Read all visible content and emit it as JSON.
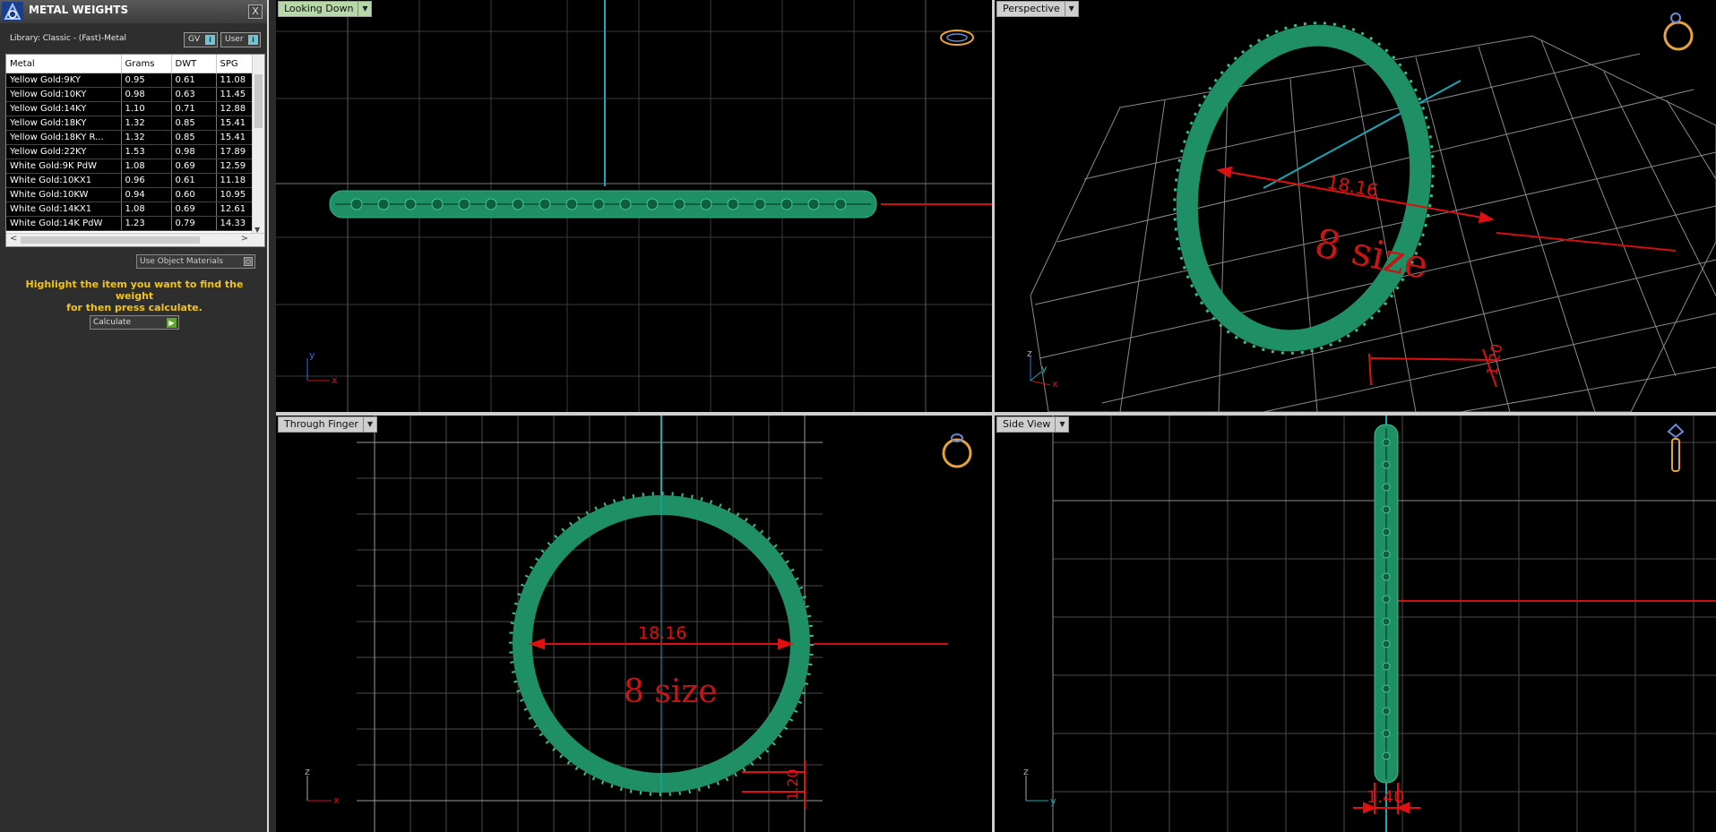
{
  "panel": {
    "title": "METAL WEIGHTS",
    "close_label": "X",
    "library_label": "Library: Classic - (Fast)-Metal",
    "gv_label": "GV",
    "user_label": "User",
    "toggle_mark": "i",
    "columns": [
      "Metal",
      "Grams",
      "DWT",
      "SPG"
    ],
    "rows": [
      [
        "Yellow Gold:9KY",
        "0.95",
        "0.61",
        "11.08"
      ],
      [
        "Yellow Gold:10KY",
        "0.98",
        "0.63",
        "11.45"
      ],
      [
        "Yellow Gold:14KY",
        "1.10",
        "0.71",
        "12.88"
      ],
      [
        "Yellow Gold:18KY",
        "1.32",
        "0.85",
        "15.41"
      ],
      [
        "Yellow Gold:18KY R...",
        "1.32",
        "0.85",
        "15.41"
      ],
      [
        "Yellow Gold:22KY",
        "1.53",
        "0.98",
        "17.89"
      ],
      [
        "White Gold:9K PdW",
        "1.08",
        "0.69",
        "12.59"
      ],
      [
        "White Gold:10KX1",
        "0.96",
        "0.61",
        "11.18"
      ],
      [
        "White Gold:10KW",
        "0.94",
        "0.60",
        "10.95"
      ],
      [
        "White Gold:14KX1",
        "1.08",
        "0.69",
        "12.61"
      ],
      [
        "White Gold:14K PdW",
        "1.23",
        "0.79",
        "14.33"
      ]
    ],
    "use_materials_label": "Use Object Materials",
    "instructions_line1": "Highlight the item you want to find the weight",
    "instructions_line2": "for then press calculate.",
    "calculate_label": "Calculate"
  },
  "viewports": {
    "top": {
      "label": "Looking Down"
    },
    "perspective": {
      "label": "Perspective",
      "dimension": "18.16",
      "size_text": "8 size",
      "width_dim": "1.20"
    },
    "front": {
      "label": "Through Finger",
      "dimension": "18.16",
      "size_text": "8 size",
      "width_dim": "1.20"
    },
    "side": {
      "label": "Side View",
      "dimension": "1.40"
    }
  },
  "axis_labels": {
    "x": "x",
    "y": "y",
    "z": "z"
  },
  "colors": {
    "ring": "#1f8f66",
    "dimension": "#e01010",
    "axis_red": "#d01010",
    "axis_cyan": "#1aa7b8",
    "highlight": "#f0c419"
  }
}
